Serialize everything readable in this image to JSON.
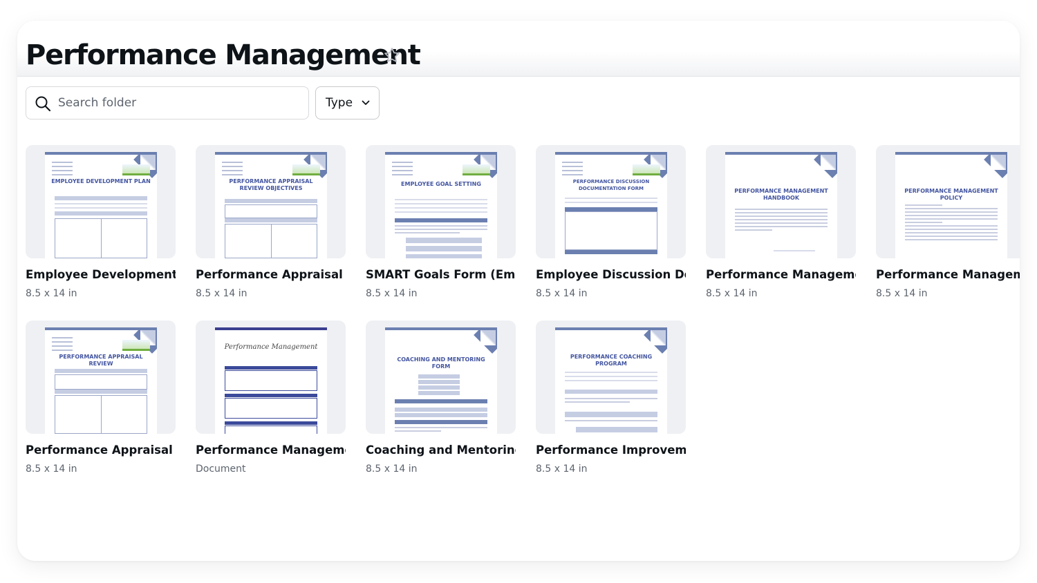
{
  "folder": {
    "title": "Performance Management",
    "star_icon": "star-outline-icon"
  },
  "search": {
    "placeholder": "Search folder",
    "icon": "search-icon"
  },
  "filters": {
    "type_label": "Type",
    "type_icon": "chevron-down-icon"
  },
  "colors": {
    "accent": "#6b7fb0",
    "heading_blue": "#4355a0",
    "thumb_bg": "#eff0f3"
  },
  "designs": [
    {
      "title": "Employee Development ...",
      "meta": "8.5 x 14 in",
      "thumb_heading": "EMPLOYEE DEVELOPMENT PLAN"
    },
    {
      "title": "Performance Appraisal ...",
      "meta": "8.5 x 14 in",
      "thumb_heading": "PERFORMANCE APPRAISAL REVIEW OBJECTIVES"
    },
    {
      "title": "SMART Goals Form (Em...",
      "meta": "8.5 x 14 in",
      "thumb_heading": "EMPLOYEE GOAL SETTING"
    },
    {
      "title": "Employee Discussion Do...",
      "meta": "8.5 x 14 in",
      "thumb_heading": "PERFORMANCE DISCUSSION DOCUMENTATION FORM"
    },
    {
      "title": "Performance Manageme...",
      "meta": "8.5 x 14 in",
      "thumb_heading": "PERFORMANCE MANAGEMENT HANDBOOK"
    },
    {
      "title": "Performance Manageme...",
      "meta": "8.5 x 14 in",
      "thumb_heading": "PERFORMANCE MANAGEMENT POLICY"
    },
    {
      "title": "Performance Appraisal ...",
      "meta": "8.5 x 14 in",
      "thumb_heading": "PERFORMANCE APPRAISAL REVIEW"
    },
    {
      "title": "Performance Manageme...",
      "meta": "Document",
      "thumb_heading": "Performance Management"
    },
    {
      "title": "Coaching and Mentoring...",
      "meta": "8.5 x 14 in",
      "thumb_heading": "COACHING AND MENTORING FORM"
    },
    {
      "title": "Performance Improvem...",
      "meta": "8.5 x 14 in",
      "thumb_heading": "PERFORMANCE COACHING PROGRAM"
    }
  ]
}
